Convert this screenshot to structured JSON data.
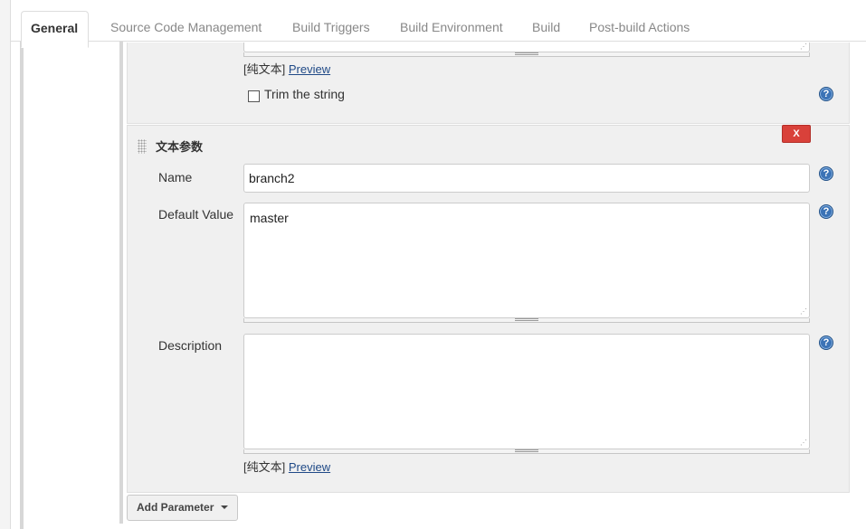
{
  "tabs": [
    {
      "label": "General",
      "active": true
    },
    {
      "label": "Source Code Management"
    },
    {
      "label": "Build Triggers"
    },
    {
      "label": "Build Environment"
    },
    {
      "label": "Build"
    },
    {
      "label": "Post-build Actions"
    }
  ],
  "previous_parameter": {
    "format_text": "[纯文本]",
    "preview_link": "Preview",
    "trim_label": "Trim the string",
    "trim_checked": false
  },
  "text_parameter": {
    "title": "文本参数",
    "delete_label": "X",
    "name_label": "Name",
    "name_value": "branch2",
    "default_label": "Default Value",
    "default_value": "master",
    "description_label": "Description",
    "description_value": "",
    "format_text": "[纯文本]",
    "preview_link": "Preview"
  },
  "help_icon": "?",
  "add_parameter_label": "Add Parameter",
  "colors": {
    "delete_button": "#d9413a",
    "help_icon": "#3b73b6",
    "link": "#204a87",
    "panel_background": "#f0f0f0"
  }
}
